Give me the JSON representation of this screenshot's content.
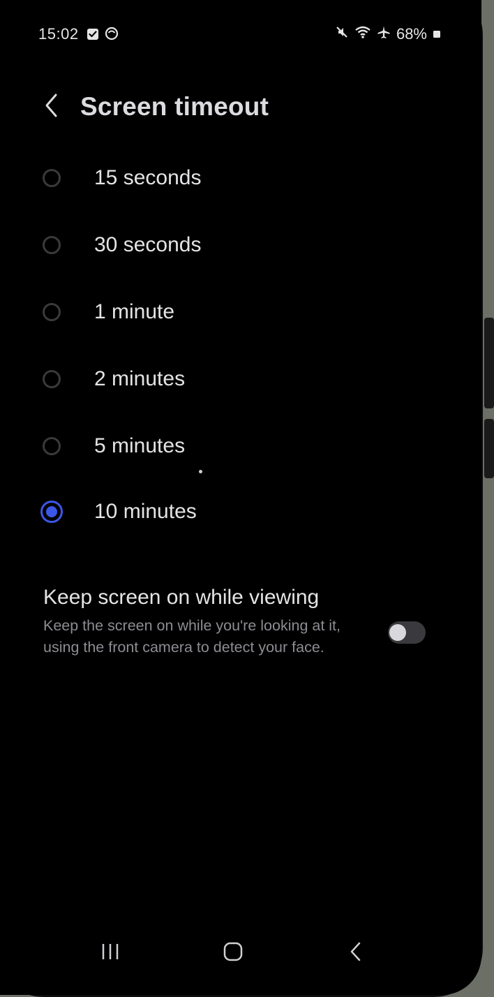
{
  "status_bar": {
    "time": "15:02",
    "battery": "68%",
    "icons_left": [
      "checkbox-notification-icon",
      "circle-app-icon"
    ],
    "icons_right": [
      "mute-icon",
      "wifi-icon",
      "airplane-icon",
      "battery-icon"
    ]
  },
  "header": {
    "title": "Screen timeout",
    "back_icon": "chevron-left-icon"
  },
  "options": [
    {
      "label": "15 seconds",
      "selected": false
    },
    {
      "label": "30 seconds",
      "selected": false
    },
    {
      "label": "1 minute",
      "selected": false
    },
    {
      "label": "2 minutes",
      "selected": false
    },
    {
      "label": "5 minutes",
      "selected": false
    },
    {
      "label": "10 minutes",
      "selected": true
    }
  ],
  "keep_screen_on": {
    "title": "Keep screen on while viewing",
    "description": "Keep the screen on while you're looking at it, using the front camera to detect your face.",
    "enabled": false
  },
  "nav_bar": {
    "recents_icon": "recents-icon",
    "home_icon": "home-icon",
    "back_icon": "back-icon"
  },
  "colors": {
    "accent": "#3b57e8",
    "background": "#000000",
    "text_primary": "#e4e4e6",
    "text_secondary": "#8c8c92"
  }
}
